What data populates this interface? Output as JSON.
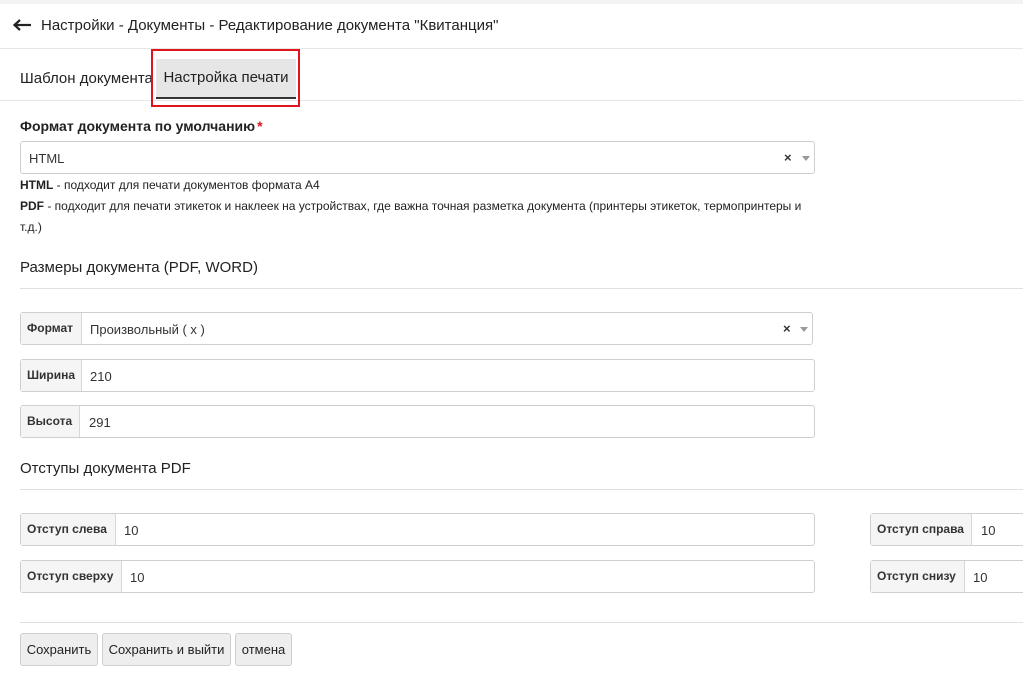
{
  "header": {
    "title": "Настройки - Документы - Редактирование документа \"Квитанция\"",
    "back_icon": "arrow-left-icon"
  },
  "tabs": [
    {
      "label": "Шаблон документа",
      "active": false
    },
    {
      "label": "Настройка печати",
      "active": true,
      "highlighted": true
    }
  ],
  "format": {
    "label": "Формат документа по умолчанию",
    "required_mark": "*",
    "value": "HTML",
    "clear_icon": "×",
    "hints": [
      {
        "term": "HTML",
        "text": " - подходит для печати документов формата А4"
      },
      {
        "term": "PDF",
        "text": " - подходит для печати этикеток и наклеек на устройствах, где важна точная разметка документа (принтеры этикеток, термопринтеры и"
      },
      {
        "term": "",
        "text": "т.д.)"
      }
    ]
  },
  "size_section": {
    "title": "Размеры документа (PDF, WORD)",
    "format_label": "Формат",
    "format_value": "Произвольный ( x )",
    "clear_icon": "×",
    "width_label": "Ширина",
    "width_value": "210",
    "height_label": "Высота",
    "height_value": "291"
  },
  "margins_section": {
    "title": "Отступы документа PDF",
    "left_label": "Отступ слева",
    "left_value": "10",
    "right_label": "Отступ справа",
    "right_value": "10",
    "top_label": "Отступ сверху",
    "top_value": "10",
    "bottom_label": "Отступ снизу",
    "bottom_value": "10"
  },
  "buttons": {
    "save": "Сохранить",
    "save_exit": "Сохранить и выйти",
    "cancel": "отмена"
  },
  "colors": {
    "highlight_frame": "#e0141c",
    "required": "#d9141c",
    "active_tab_bg": "#e6e6e6"
  }
}
